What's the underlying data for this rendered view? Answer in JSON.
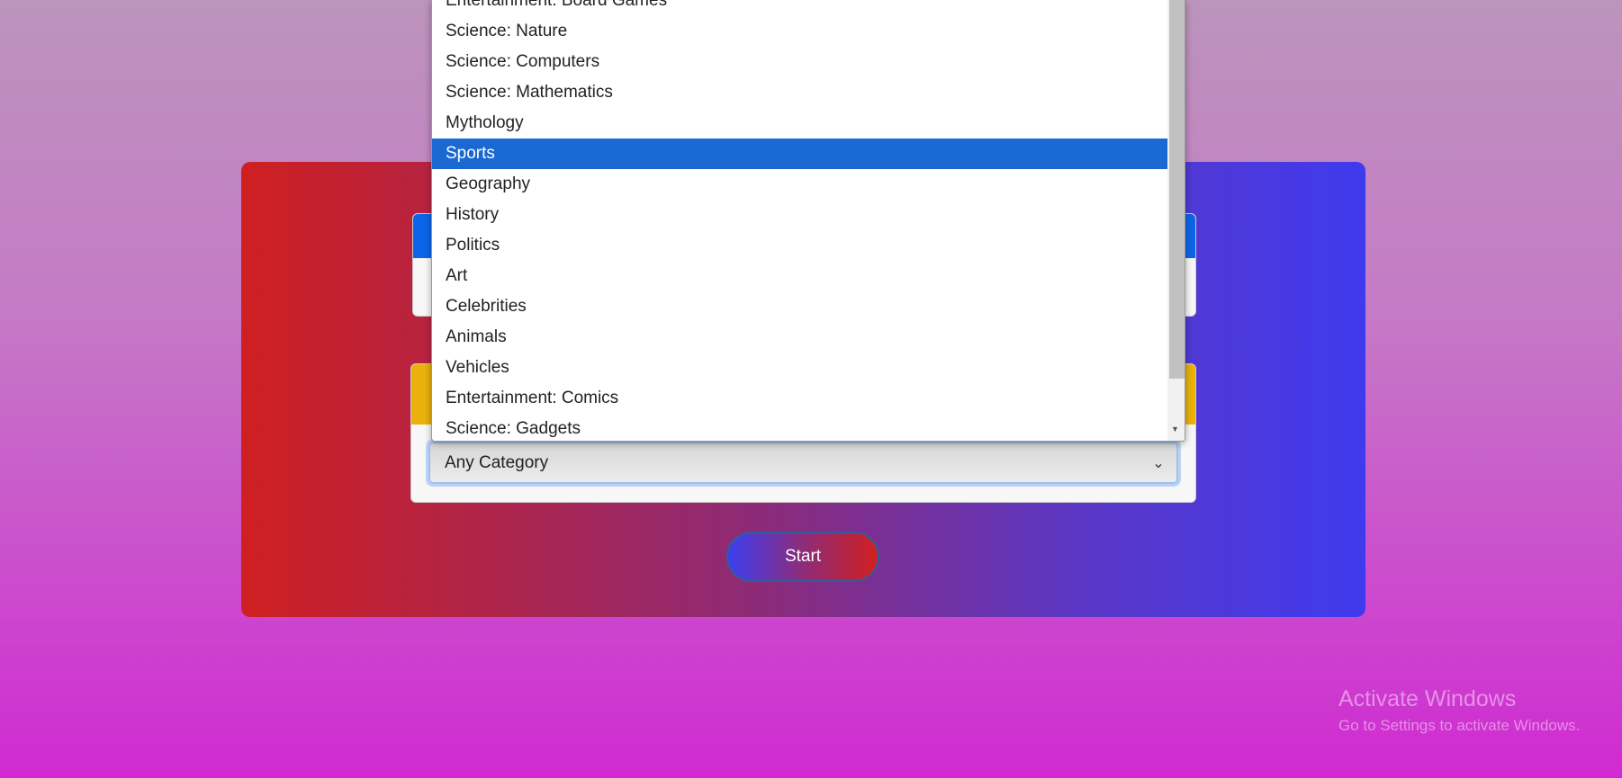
{
  "dropdown": {
    "options": [
      "Entertainment: Board Games",
      "Science: Nature",
      "Science: Computers",
      "Science: Mathematics",
      "Mythology",
      "Sports",
      "Geography",
      "History",
      "Politics",
      "Art",
      "Celebrities",
      "Animals",
      "Vehicles",
      "Entertainment: Comics",
      "Science: Gadgets"
    ],
    "highlighted": "Sports"
  },
  "category_select": {
    "value": "Any Category",
    "icon": "chevron-down-icon"
  },
  "start_label": "Start",
  "watermark": {
    "title": "Activate Windows",
    "subtitle": "Go to Settings to activate Windows."
  },
  "colors": {
    "highlight": "#1a68d2",
    "panel1_header": "#0b65e6",
    "panel2_header": "#e9b10a"
  }
}
